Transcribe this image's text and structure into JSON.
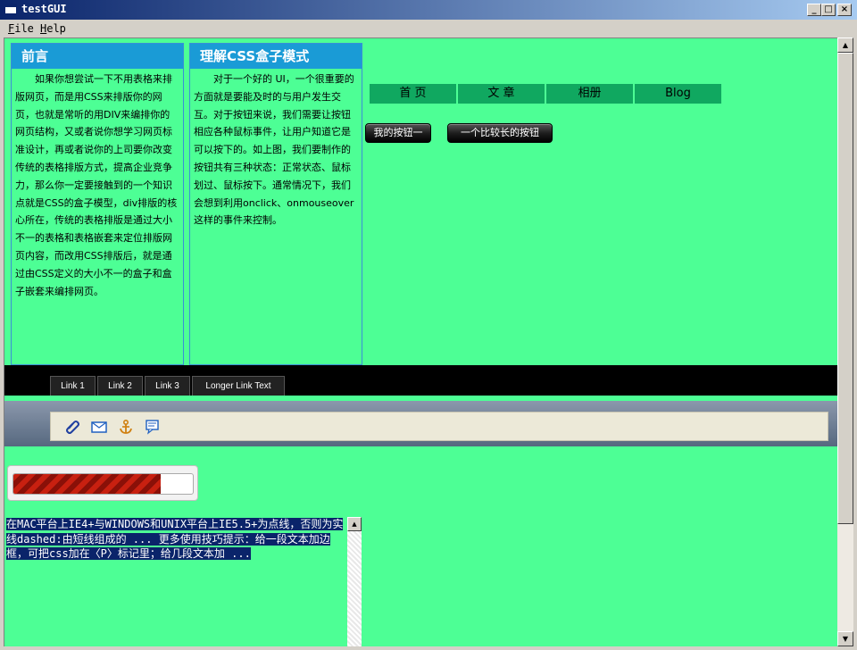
{
  "window": {
    "title": "testGUI",
    "min": "_",
    "max": "□",
    "close": "×"
  },
  "menu": [
    {
      "label": "File"
    },
    {
      "label": "Help"
    }
  ],
  "panels": [
    {
      "title": "前言",
      "body": "如果你想尝试一下不用表格来排版网页，而是用CSS来排版你的网页，也就是常听的用DIV来编排你的网页结构，又或者说你想学习网页标准设计，再或者说你的上司要你改变传统的表格排版方式，提高企业竞争力，那么你一定要接触到的一个知识点就是CSS的盒子模型，div排版的核心所在，传统的表格排版是通过大小不一的表格和表格嵌套来定位排版网页内容，而改用CSS排版后，就是通过由CSS定义的大小不一的盒子和盒子嵌套来编排网页。"
    },
    {
      "title": "理解CSS盒子模式",
      "body": "对于一个好的 UI，一个很重要的方面就是要能及时的与用户发生交互。对于按钮来说，我们需要让按钮相应各种鼠标事件，让用户知道它是可以按下的。如上图，我们要制作的按钮共有三种状态：正常状态、鼠标划过、鼠标按下。通常情况下，我们会想到利用onclick、onmouseover这样的事件来控制。"
    }
  ],
  "nav": [
    {
      "label": "首 页"
    },
    {
      "label": "文 章"
    },
    {
      "label": "相册"
    },
    {
      "label": "Blog"
    }
  ],
  "buttons": [
    {
      "label": "我的按钮一"
    },
    {
      "label": "一个比较长的按钮"
    }
  ],
  "tabs": [
    {
      "label": "Link 1"
    },
    {
      "label": "Link 2"
    },
    {
      "label": "Link 3"
    },
    {
      "label": "Longer Link Text"
    }
  ],
  "toolbar_icons": [
    "paperclip-icon",
    "mail-icon",
    "anchor-icon",
    "comment-icon"
  ],
  "progress": {
    "value": 0.82
  },
  "textarea": {
    "value": "在MAC平台上IE4+与WINDOWS和UNIX平台上IE5.5+为点线，否则为实线dashed:由短线组成的 ... 更多使用技巧提示：给一段文本加边框，可把css加在〈P〉标记里；给几段文本加 ..."
  },
  "colors": {
    "client_bg": "#4dff95",
    "panel_header": "#1a9bd6",
    "nav_bg": "#10a860",
    "selection": "#0a246a"
  }
}
